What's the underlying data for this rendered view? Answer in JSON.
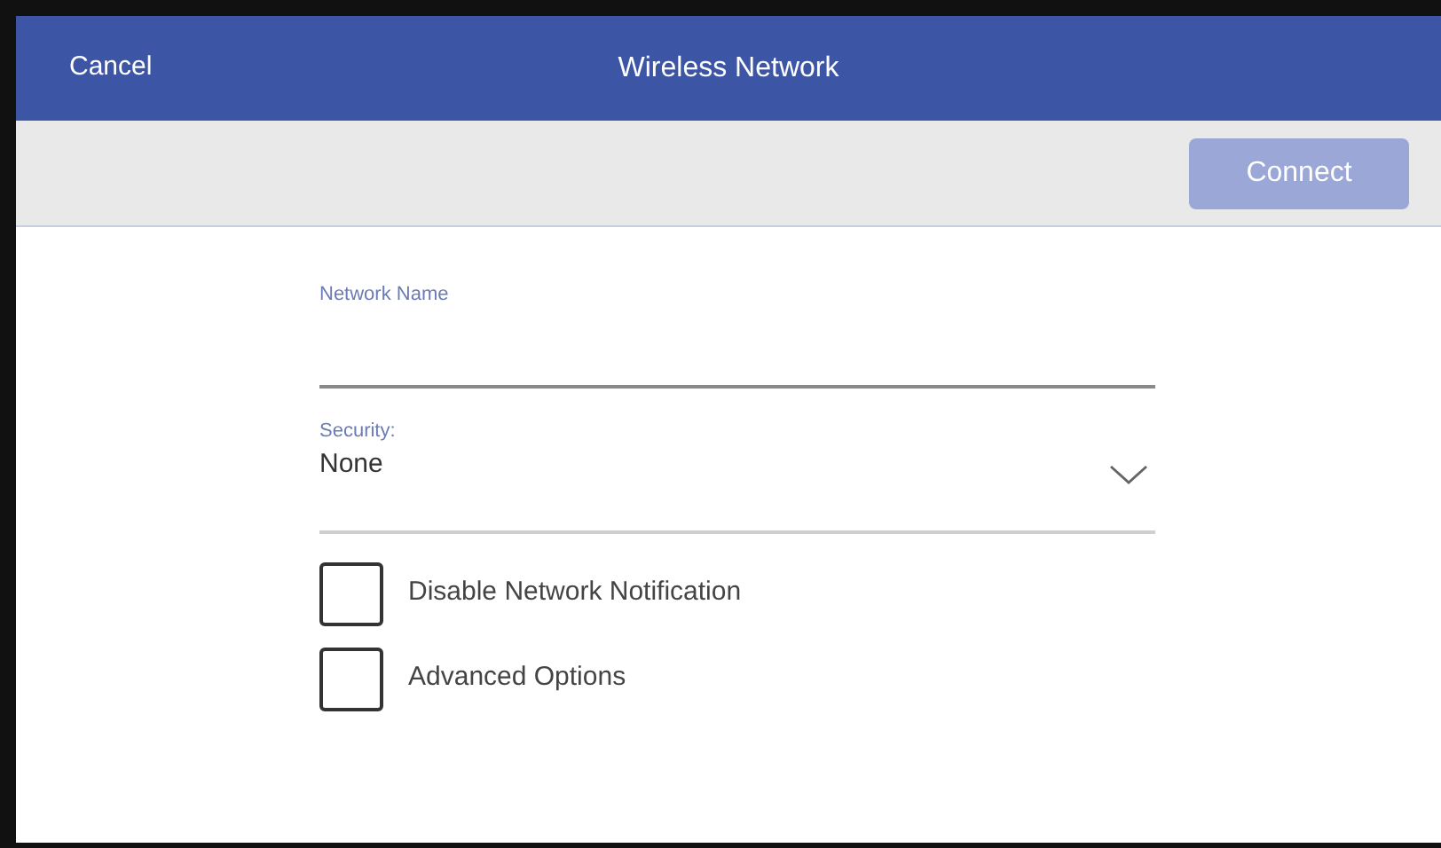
{
  "header": {
    "cancel": "Cancel",
    "title": "Wireless Network"
  },
  "toolbar": {
    "connect": {
      "label": "Connect",
      "disabled": true
    }
  },
  "network_name": {
    "label": "Network Name"
  },
  "security": {
    "label": "Security:",
    "value": "None"
  },
  "options": [
    {
      "label": "Disable Network Notification",
      "checked": false
    },
    {
      "label": "Advanced Options",
      "checked": false
    }
  ]
}
